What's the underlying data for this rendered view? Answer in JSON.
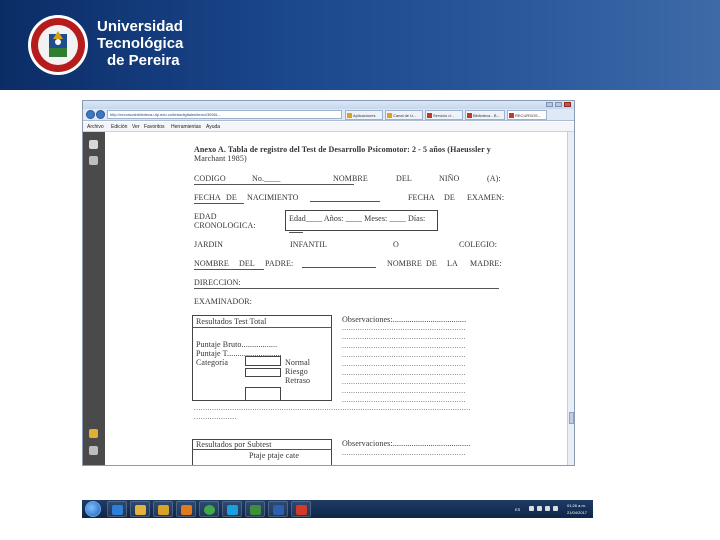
{
  "banner": {
    "logo_line1": "Universidad",
    "logo_line2": "Tecnológica",
    "logo_line3": "de Pereira"
  },
  "browser": {
    "url": "http://recursosbiblioteca.utp.edu.co/tesisdigitales/texto/3056L...",
    "tabs": [
      {
        "label": "Aplicaciones"
      },
      {
        "label": "Canal de U..."
      },
      {
        "label": "Servicio d..."
      },
      {
        "label": "Biblioteca - B..."
      },
      {
        "label": "RECURSOS..."
      }
    ],
    "menu": [
      "Archivo",
      "Edición",
      "Ver",
      "Favoritos",
      "Herramientas",
      "Ayuda"
    ]
  },
  "document": {
    "heading_line1": "Anexo A. Tabla de registro del Test de Desarrollo Psicomotor: 2 - 5 años (Haeussler y",
    "heading_line2": "Marchant 1985)",
    "codigo": "CODIGO",
    "no": "No.____",
    "nombre": "NOMBRE",
    "del": "DEL",
    "nino": "NIÑO",
    "a": "(A):",
    "fecha": "FECHA",
    "de": "DE",
    "nacimiento": "NACIMIENTO",
    "fecha2": "FECHA",
    "de2": "DE",
    "examen": "EXAMEN:",
    "edad": "EDAD",
    "cronologica": "CRONOLOGICA:",
    "edad_box": "Edad____ Años: ____   Meses: ____  Días:",
    "jardin": "JARDIN",
    "infantil": "INFANTIL",
    "o": "O",
    "colegio": "COLEGIO:",
    "nombre_padre_1": "NOMBRE",
    "nombre_padre_2": "DEL",
    "nombre_padre_3": "PADRE:",
    "nombre_madre_1": "NOMBRE",
    "nombre_madre_2": "DE",
    "nombre_madre_3": "LA",
    "nombre_madre_4": "MADRE:",
    "direccion": "DIRECCION:",
    "examinador": "EXAMINADOR:",
    "resultados_total": "Resultados  Test  Total",
    "puntaje_bruto": "Puntaje Bruto.................",
    "puntaje_t": "Puntaje T..........................",
    "categoria": "Categoría",
    "normal": "Normal",
    "riesgo": "Riesgo",
    "retraso": "Retraso",
    "observaciones": "Observaciones:...................................",
    "dots": ".......................................................",
    "long_dots": "...........................................................................................................................",
    "short_dots": "...................",
    "resultados_subtest": "Resultados por Subtest",
    "observaciones2": "Observaciones:.....................................",
    "col_headers": "Ptaje   ptaje    cate"
  },
  "taskbar": {
    "lang": "ES",
    "time": "01:26 a.m.",
    "date": "21/04/2017"
  },
  "colors": {
    "banner_dark": "#0b2d66",
    "banner_light": "#3e6aa8"
  }
}
